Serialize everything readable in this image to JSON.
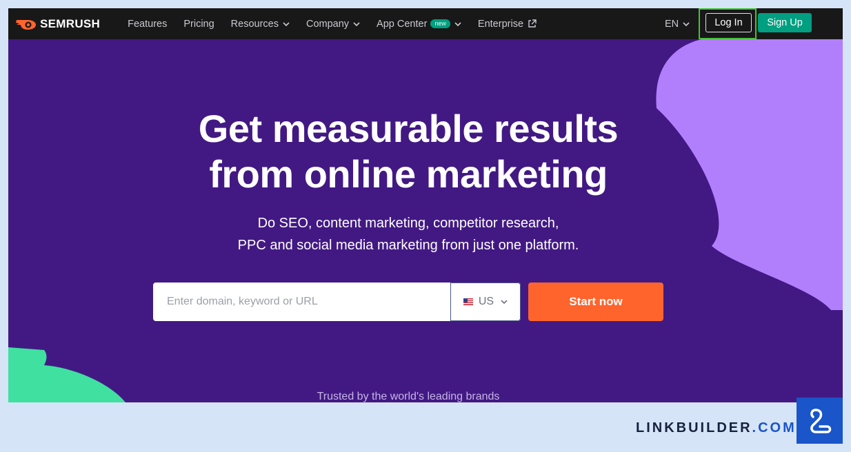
{
  "nav": {
    "brand": "SEMRUSH",
    "links": [
      {
        "label": "Features",
        "has_dropdown": false
      },
      {
        "label": "Pricing",
        "has_dropdown": false
      },
      {
        "label": "Resources",
        "has_dropdown": true
      },
      {
        "label": "Company",
        "has_dropdown": true
      },
      {
        "label": "App Center",
        "has_dropdown": true,
        "badge": "new"
      },
      {
        "label": "Enterprise",
        "external": true
      }
    ],
    "language": "EN",
    "login_label": "Log In",
    "signup_label": "Sign Up"
  },
  "hero": {
    "title_line1": "Get measurable results",
    "title_line2": "from online marketing",
    "subtitle_line1": "Do SEO, content marketing, competitor research,",
    "subtitle_line2": "PPC and social media marketing from just one platform."
  },
  "search": {
    "placeholder": "Enter domain, keyword or URL",
    "value": "",
    "country": "US",
    "submit_label": "Start now"
  },
  "trusted_text": "Trusted by the world's leading brands",
  "footer_brand": {
    "name_part": "LINKBUILDER",
    "dot": ".",
    "tld": "COM"
  },
  "colors": {
    "hero_bg": "#421983",
    "nav_bg": "#181818",
    "accent_orange": "#ff642d",
    "signup_green": "#009f81",
    "deco_purple": "#b27ffc",
    "deco_green": "#3fe0a0",
    "highlight_border": "#47c03a",
    "page_bg": "#d6e4f7",
    "brand_blue": "#1a55c9"
  }
}
